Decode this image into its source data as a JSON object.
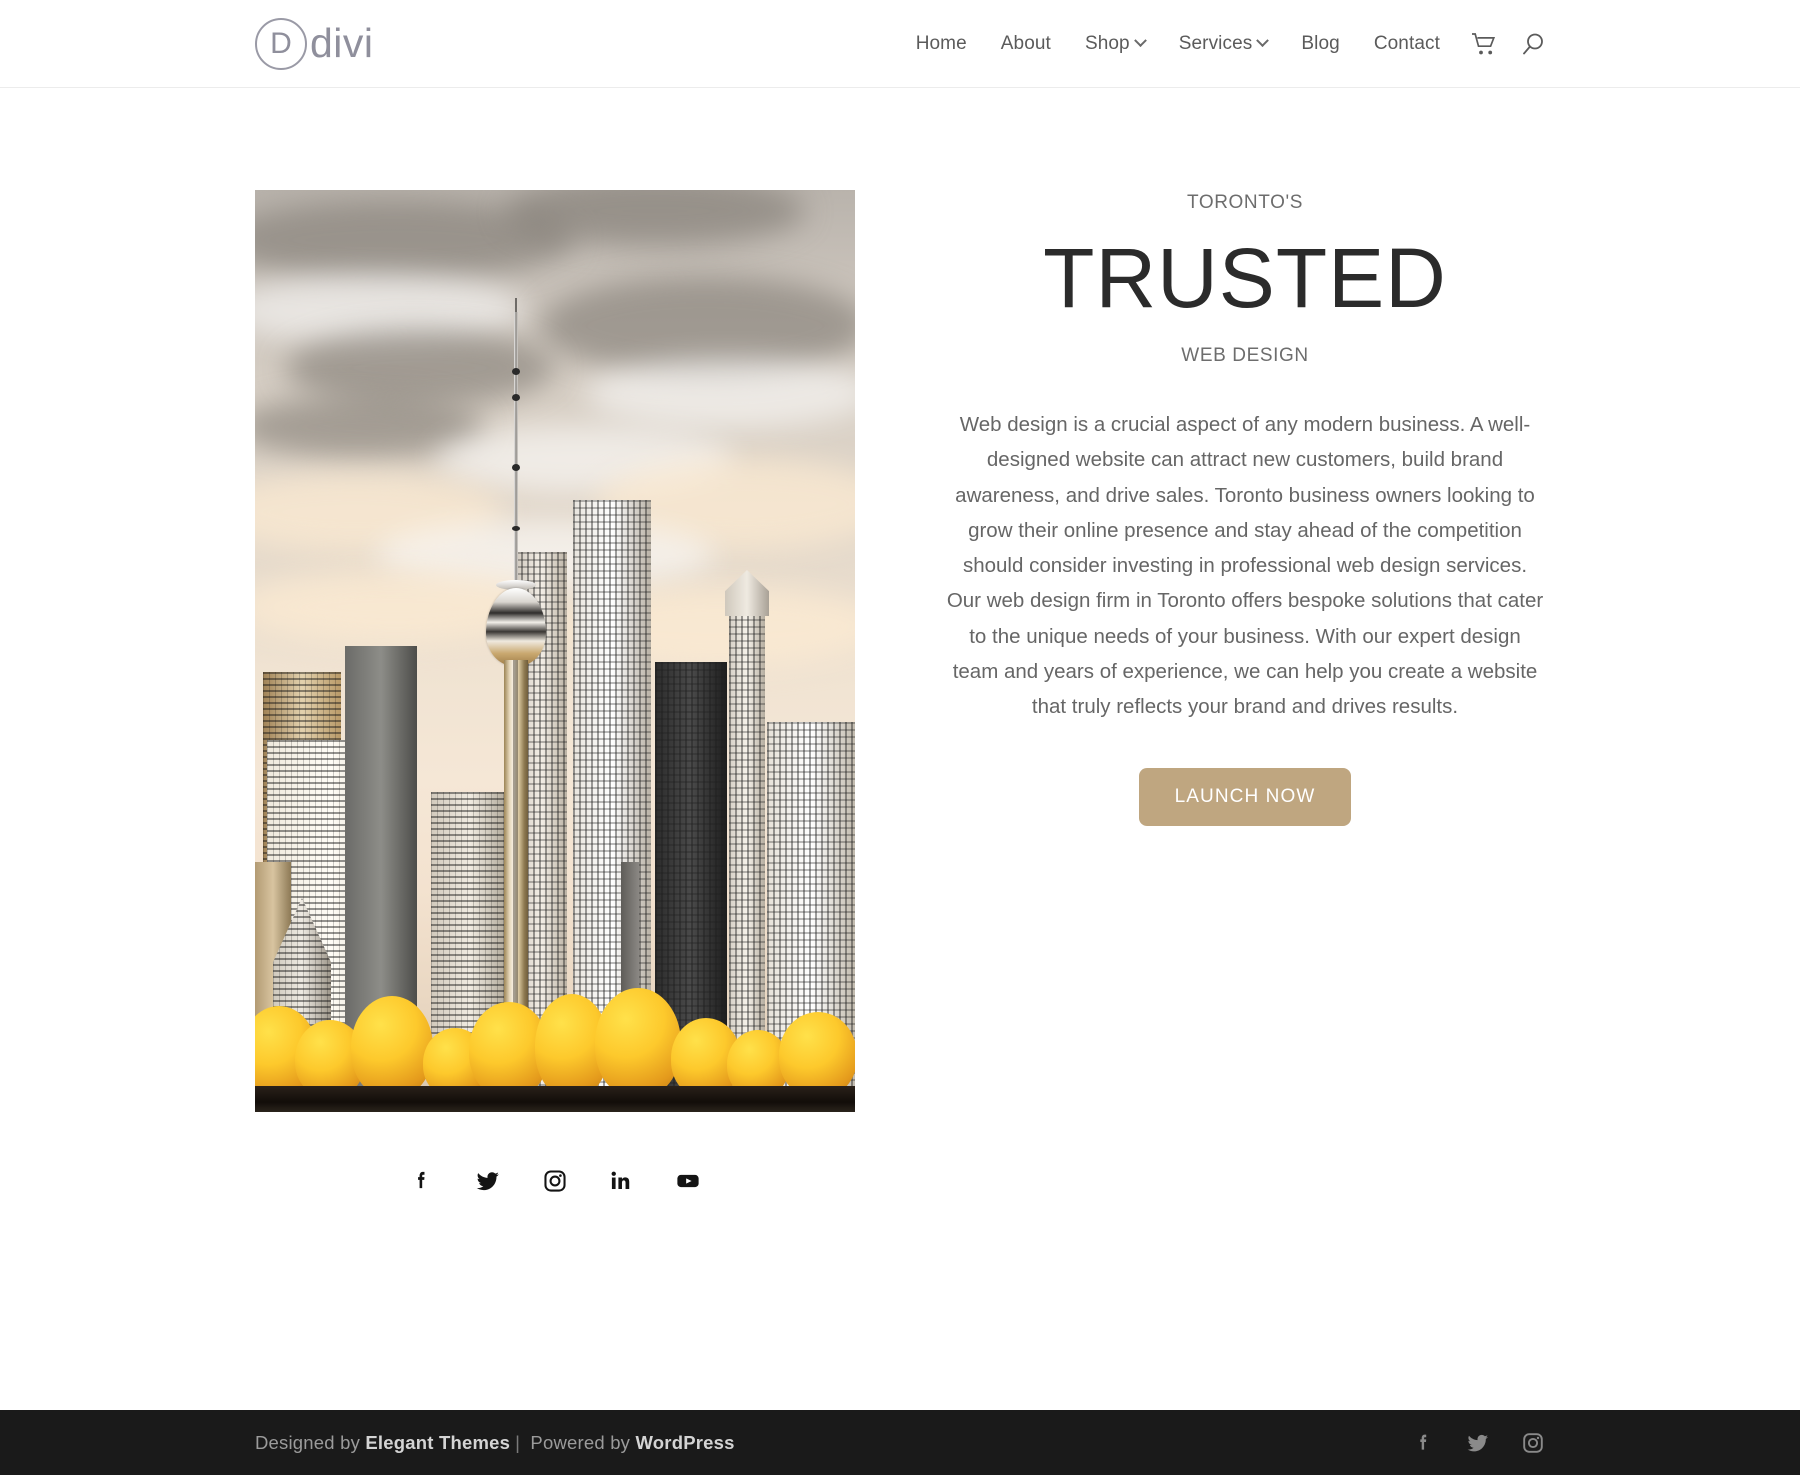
{
  "header": {
    "logo": {
      "mark": "D",
      "text": "divi",
      "name": "divi-logo"
    },
    "nav": [
      {
        "label": "Home",
        "has_dropdown": false
      },
      {
        "label": "About",
        "has_dropdown": false
      },
      {
        "label": "Shop",
        "has_dropdown": true
      },
      {
        "label": "Services",
        "has_dropdown": true
      },
      {
        "label": "Blog",
        "has_dropdown": false
      },
      {
        "label": "Contact",
        "has_dropdown": false
      }
    ],
    "icons": [
      {
        "name": "cart-icon",
        "label": "Cart"
      },
      {
        "name": "search-icon",
        "label": "Search"
      }
    ]
  },
  "hero": {
    "image": {
      "name": "toronto-skyline-image",
      "alt": "Toronto CN Tower skyline with autumn trees"
    },
    "eyebrow": "TORONTO'S",
    "headline": "TRUSTED",
    "subline": "WEB DESIGN",
    "body": "Web design is a crucial aspect of any modern business. A well-designed website can attract new customers, build brand awareness, and drive sales. Toronto business owners looking to grow their online presence and stay ahead of the competition should consider investing in professional web design services. Our web design firm in Toronto offers bespoke solutions that cater to the unique needs of your business. With our expert design team and years of experience, we can help you create a website that truly reflects your brand and drives results.",
    "cta_label": "LAUNCH NOW",
    "cta_color": "#bfa680",
    "social": [
      {
        "name": "facebook-icon",
        "label": "Facebook"
      },
      {
        "name": "twitter-icon",
        "label": "Twitter"
      },
      {
        "name": "instagram-icon",
        "label": "Instagram"
      },
      {
        "name": "linkedin-icon",
        "label": "LinkedIn"
      },
      {
        "name": "youtube-icon",
        "label": "YouTube"
      }
    ]
  },
  "footer": {
    "credit_prefix": "Designed by ",
    "credit_brand": "Elegant Themes",
    "credit_sep": "|",
    "credit_middle": " Powered by ",
    "credit_platform": "WordPress",
    "background": "#1a1a1a",
    "social": [
      {
        "name": "facebook-icon",
        "label": "Facebook"
      },
      {
        "name": "twitter-icon",
        "label": "Twitter"
      },
      {
        "name": "instagram-icon",
        "label": "Instagram"
      }
    ]
  }
}
